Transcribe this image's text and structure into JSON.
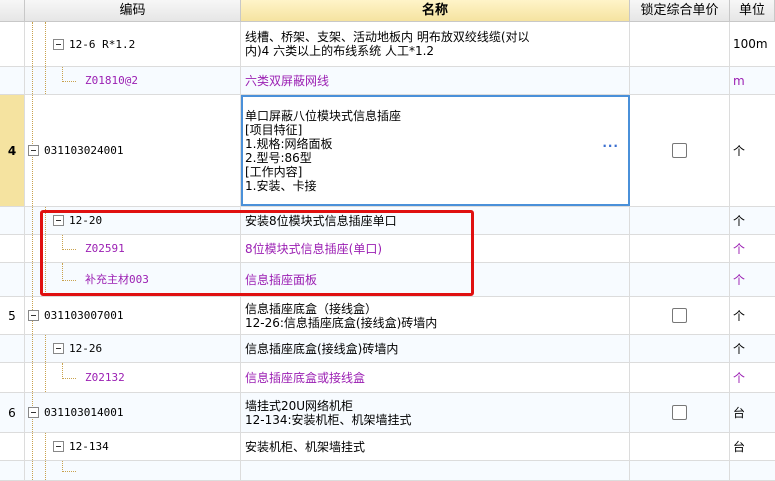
{
  "columns": {
    "code": "编码",
    "name": "名称",
    "lock_price": "锁定综合单价",
    "unit": "单位"
  },
  "rows": [
    {
      "num": "",
      "code": "12-6 R*1.2",
      "name_lines": [
        "线槽、桥架、支架、活动地板内 明布放双绞线缆(对以",
        "内)4  六类以上的布线系统 人工*1.2"
      ],
      "unit": "100m",
      "color": "black",
      "checkbox": false
    },
    {
      "num": "",
      "code": "Z01810@2",
      "name_lines": [
        "六类双屏蔽网线"
      ],
      "unit": "m",
      "color": "purple",
      "checkbox": false
    },
    {
      "num": "4",
      "code": "031103024001",
      "name_lines": [
        "单口屏蔽八位模块式信息插座",
        "[项目特征]",
        "1.规格:网络面板",
        "2.型号:86型",
        "[工作内容]",
        "1.安装、卡接"
      ],
      "unit": "个",
      "color": "black",
      "checkbox": true
    },
    {
      "num": "",
      "code": "12-20",
      "name_lines": [
        "安装8位模块式信息插座单口"
      ],
      "unit": "个",
      "color": "black",
      "checkbox": false
    },
    {
      "num": "",
      "code": "Z02591",
      "name_lines": [
        "8位模块式信息插座(单口)"
      ],
      "unit": "个",
      "color": "purple",
      "checkbox": false
    },
    {
      "num": "",
      "code": "补充主材003",
      "name_lines": [
        "信息插座面板"
      ],
      "unit": "个",
      "color": "purple",
      "checkbox": false
    },
    {
      "num": "5",
      "code": "031103007001",
      "name_lines": [
        "信息插座底盒（接线盒）",
        "12-26:信息插座底盒(接线盒)砖墙内"
      ],
      "unit": "个",
      "color": "black",
      "checkbox": true
    },
    {
      "num": "",
      "code": "12-26",
      "name_lines": [
        "信息插座底盒(接线盒)砖墙内"
      ],
      "unit": "个",
      "color": "black",
      "checkbox": false
    },
    {
      "num": "",
      "code": "Z02132",
      "name_lines": [
        "信息插座底盒或接线盒"
      ],
      "unit": "个",
      "color": "purple",
      "checkbox": false
    },
    {
      "num": "6",
      "code": "031103014001",
      "name_lines": [
        "墙挂式20U网络机柜",
        "12-134:安装机柜、机架墙挂式"
      ],
      "unit": "台",
      "color": "black",
      "checkbox": true
    },
    {
      "num": "",
      "code": "12-134",
      "name_lines": [
        "安装机柜、机架墙挂式"
      ],
      "unit": "台",
      "color": "black",
      "checkbox": false
    },
    {
      "num": "",
      "code": "",
      "name_lines": [
        ""
      ],
      "unit": "",
      "color": "black",
      "checkbox": false
    }
  ],
  "icons": {
    "collapse": "minus-box-icon",
    "more": "ellipsis-icon",
    "checkbox": "checkbox-icon"
  }
}
